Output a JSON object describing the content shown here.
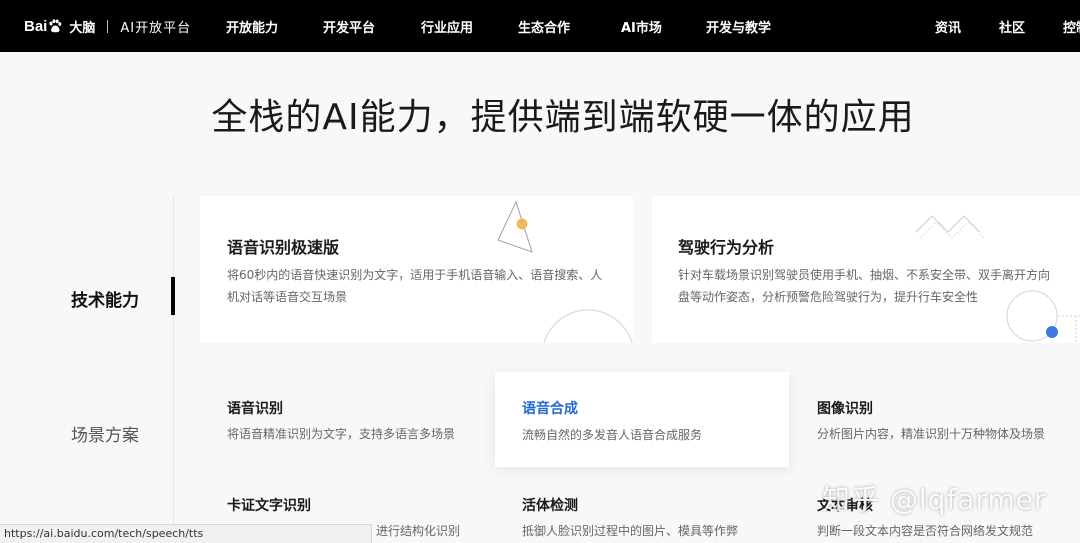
{
  "header": {
    "logo_brand": "Bai",
    "logo_brand_end": "",
    "logo_cn": "大脑",
    "logo_product": "AI开放平台",
    "nav": [
      "开放能力",
      "开发平台",
      "行业应用",
      "生态合作",
      "AI市场",
      "开发与教学",
      "资讯",
      "社区",
      "控制台"
    ]
  },
  "hero": {
    "title": "全栈的AI能力，提供端到端软硬一体的应用"
  },
  "side_tabs": {
    "active": "技术能力",
    "other": "场景方案"
  },
  "featured_cards": [
    {
      "title": "语音识别极速版",
      "desc": "将60秒内的语音快速识别为文字，适用于手机语音输入、语音搜索、人机对话等语音交互场景"
    },
    {
      "title": "驾驶行为分析",
      "desc": "针对车载场景识别驾驶员使用手机、抽烟、不系安全带、双手离开方向盘等动作姿态，分析预警危险驾驶行为，提升行车安全性"
    }
  ],
  "grid": [
    {
      "title": "语音识别",
      "desc": "将语音精准识别为文字，支持多语言多场景"
    },
    {
      "title": "语音合成",
      "desc": "流畅自然的多发音人语音合成服务"
    },
    {
      "title": "图像识别",
      "desc": "分析图片内容，精准识别十万种物体及场景"
    },
    {
      "title": "卡证文字识别",
      "desc": "进行结构化识别"
    },
    {
      "title": "活体检测",
      "desc": "抵御人脸识别过程中的图片、模具等作弊"
    },
    {
      "title": "文本审核",
      "desc": "判断一段文本内容是否符合网络发文规范"
    }
  ],
  "status_bar": {
    "url": "https://ai.baidu.com/tech/speech/tts"
  },
  "watermark": {
    "text": "知乎 @lqfarmer"
  },
  "colors": {
    "topbar": "#000000",
    "accent_blue": "#2468d6",
    "background": "#f7f8fa",
    "card_orange_dot": "#f0b24a"
  }
}
